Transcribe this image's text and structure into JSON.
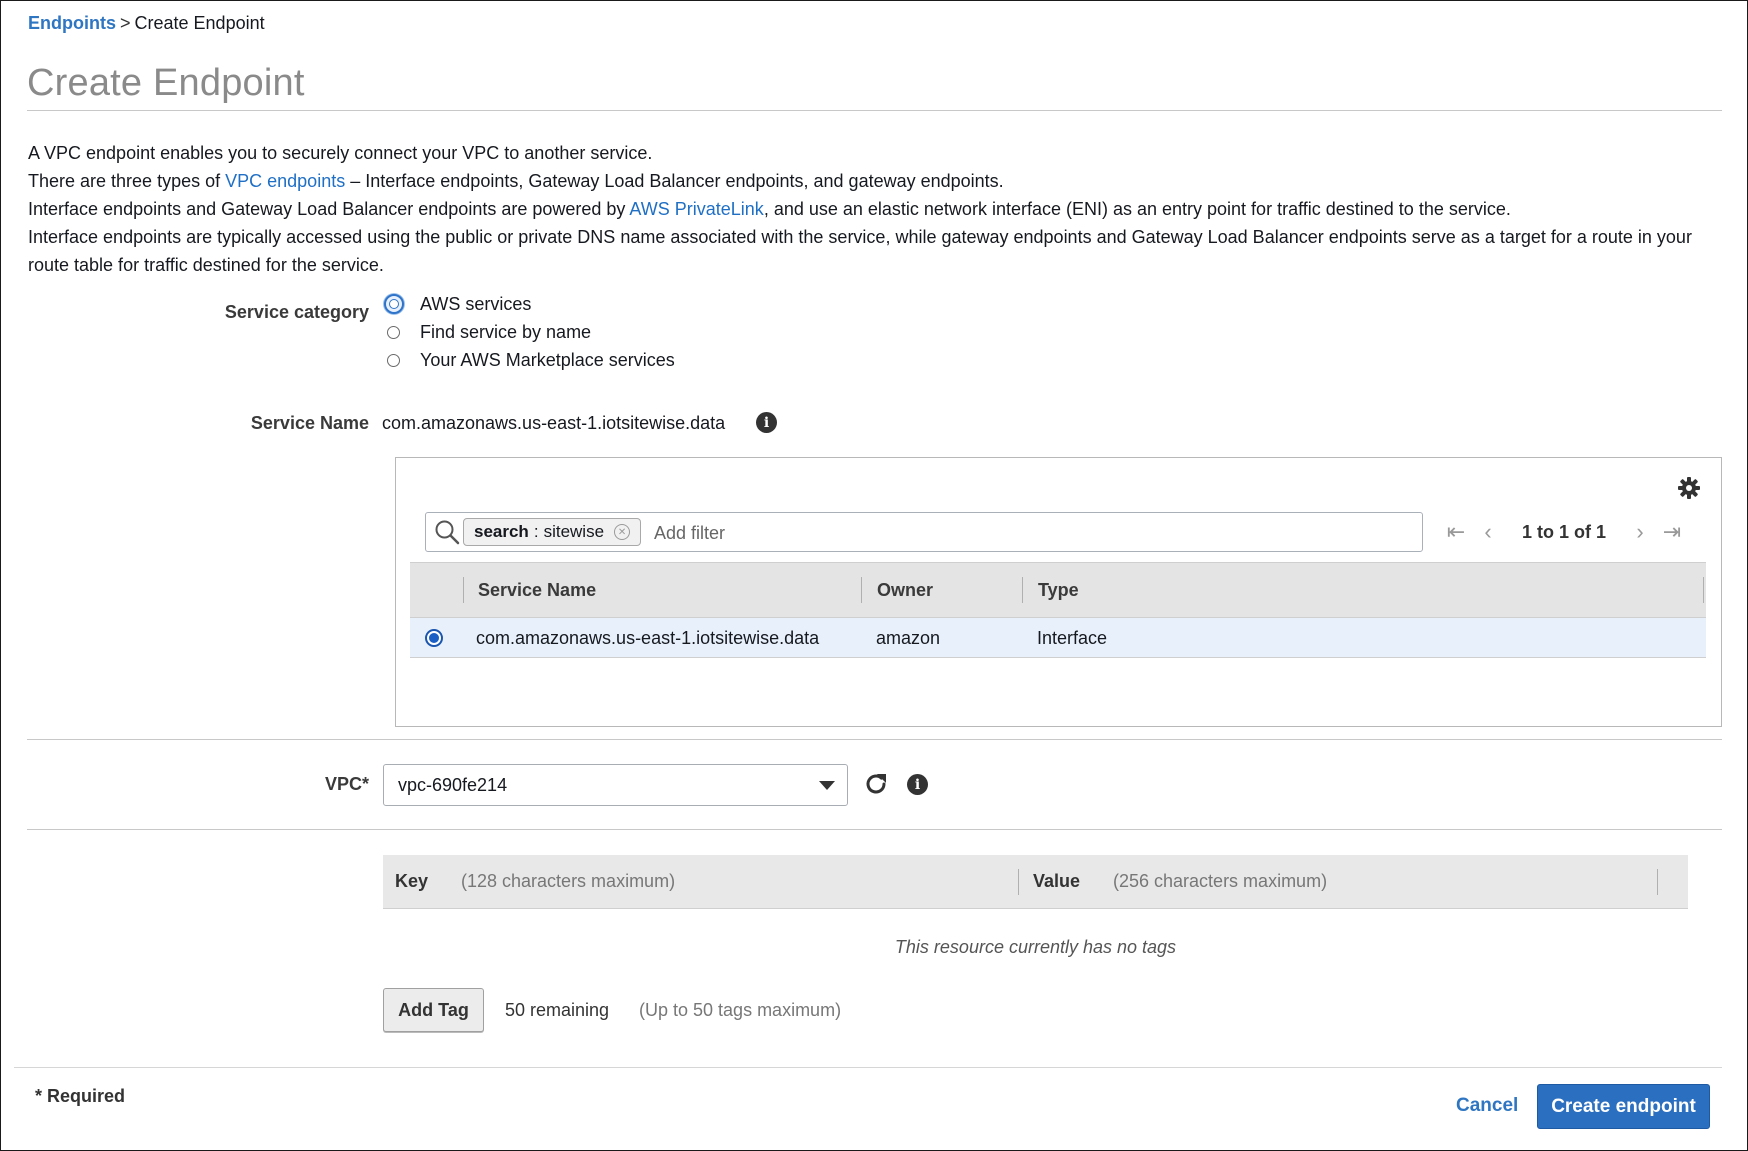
{
  "breadcrumb": {
    "parent": "Endpoints",
    "separator": ">",
    "current": "Create Endpoint"
  },
  "page_title": "Create Endpoint",
  "intro": {
    "line1": "A VPC endpoint enables you to securely connect your VPC to another service.",
    "line2_pre": "There are three types of",
    "line2_link": "VPC endpoints",
    "line2_post": "– Interface endpoints, Gateway Load Balancer endpoints, and gateway endpoints.",
    "line3_pre": "Interface endpoints and Gateway Load Balancer endpoints are powered by",
    "line3_link": "AWS PrivateLink",
    "line3_post": ", and use an elastic network interface (ENI) as an entry point for traffic destined to the service.",
    "line4": "Interface endpoints are typically accessed using the public or private DNS name associated with the service, while gateway endpoints and Gateway Load Balancer endpoints serve as a target for a route in your route table for traffic destined for the service."
  },
  "service_category": {
    "label": "Service category",
    "options": [
      {
        "label": "AWS services",
        "selected": true
      },
      {
        "label": "Find service by name",
        "selected": false
      },
      {
        "label": "Your AWS Marketplace services",
        "selected": false
      }
    ]
  },
  "service_name": {
    "label": "Service Name",
    "value": "com.amazonaws.us-east-1.iotsitewise.data",
    "icon": "info-icon"
  },
  "service_table": {
    "filter_chip": {
      "key": "search",
      "sep": ":",
      "value": "sitewise"
    },
    "filter_placeholder": "Add filter",
    "pagination": "1 to 1 of 1",
    "columns": [
      "Service Name",
      "Owner",
      "Type"
    ],
    "rows": [
      {
        "service_name": "com.amazonaws.us-east-1.iotsitewise.data",
        "owner": "amazon",
        "type": "Interface",
        "selected": true
      }
    ]
  },
  "vpc": {
    "label": "VPC*",
    "value": "vpc-690fe214",
    "icons": [
      "refresh-icon",
      "info-icon"
    ]
  },
  "tags": {
    "key_label": "Key",
    "key_hint": "(128 characters maximum)",
    "value_label": "Value",
    "value_hint": "(256 characters maximum)",
    "empty_text": "This resource currently has no tags",
    "add_button": "Add Tag",
    "remaining": "50 remaining",
    "remaining_hint": "(Up to 50 tags maximum)"
  },
  "footer": {
    "required_note": "* Required",
    "cancel": "Cancel",
    "create": "Create endpoint"
  },
  "colors": {
    "link": "#2f76c2",
    "primary_button": "#2b6fc0",
    "selected_row": "#e8f1fb"
  }
}
